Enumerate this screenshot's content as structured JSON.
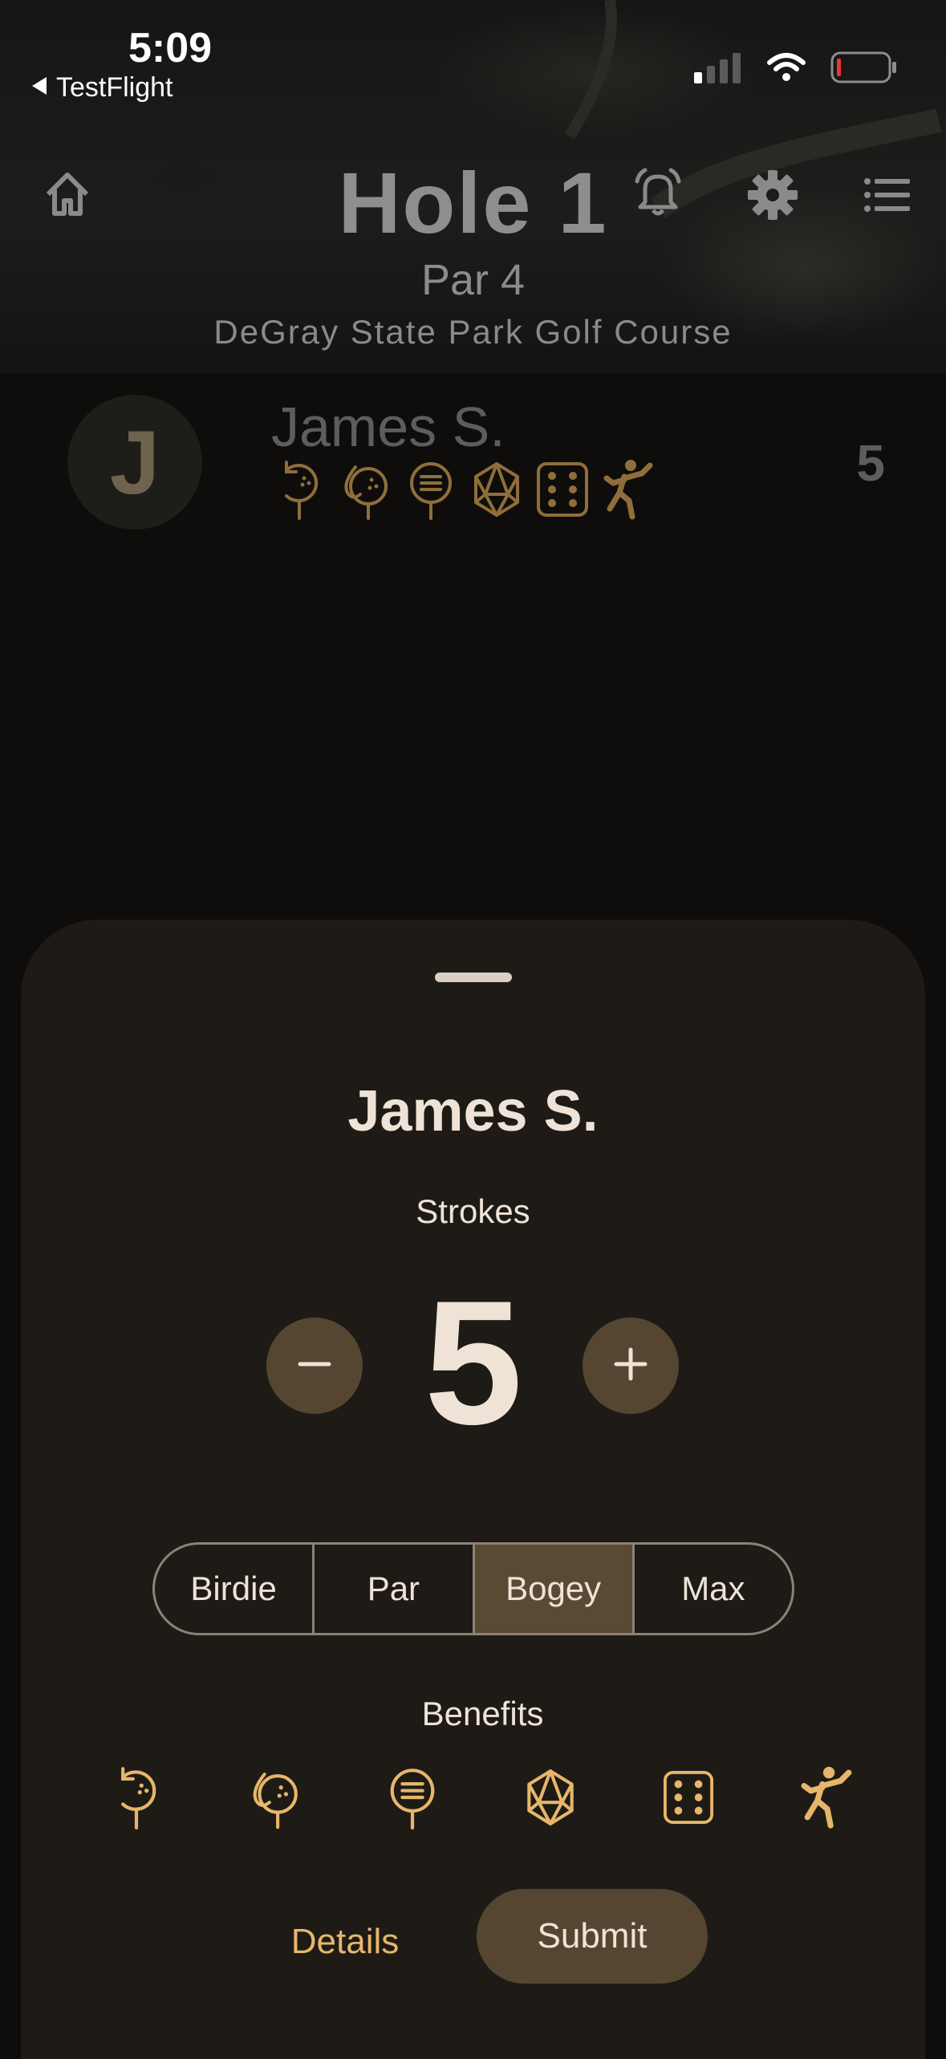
{
  "status_bar": {
    "time": "5:09",
    "back_label": "TestFlight",
    "icons": [
      "cellular-signal-icon",
      "wifi-icon",
      "battery-low-icon"
    ]
  },
  "header": {
    "title": "Hole 1",
    "par": "Par 4",
    "course": "DeGray State Park Golf Course",
    "icons": [
      "home-icon",
      "bell-icon",
      "gear-icon",
      "list-icon"
    ]
  },
  "player_row": {
    "initial": "J",
    "name": "James S.",
    "score": "5",
    "benefit_icons": [
      "mulligan-icon",
      "water-icon",
      "tee-icon",
      "d20-icon",
      "dice-icon",
      "throw-icon"
    ]
  },
  "sheet": {
    "player_name": "James S.",
    "strokes_label": "Strokes",
    "strokes_value": "5",
    "decrement_label": "−",
    "increment_label": "+",
    "options": [
      {
        "label": "Birdie",
        "selected": false
      },
      {
        "label": "Par",
        "selected": false
      },
      {
        "label": "Bogey",
        "selected": true
      },
      {
        "label": "Max",
        "selected": false
      }
    ],
    "benefits_label": "Benefits",
    "benefit_icons": [
      "mulligan-icon",
      "water-icon",
      "tee-icon",
      "d20-icon",
      "dice-icon",
      "throw-icon"
    ],
    "details_label": "Details",
    "submit_label": "Submit"
  },
  "colors": {
    "accent": "#e6b66a",
    "button_fill": "#564631",
    "sheet_bg": "#1e1b16",
    "text": "#eee3d6"
  }
}
